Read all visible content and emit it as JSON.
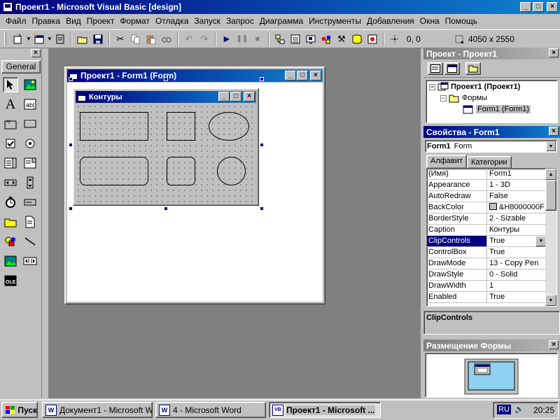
{
  "window": {
    "title": "Проект1 - Microsoft Visual Basic [design]",
    "controls": {
      "minimize": "_",
      "maximize": "□",
      "close": "×"
    }
  },
  "menu": [
    "Файл",
    "Правка",
    "Вид",
    "Проект",
    "Формат",
    "Отладка",
    "Запуск",
    "Запрос",
    "Диаграмма",
    "Инструменты",
    "Добавления",
    "Окна",
    "Помощь"
  ],
  "toolbar": {
    "position_readout": "0, 0",
    "size_readout": "4050 x 2550",
    "icons": [
      "add-project-icon",
      "add-form-icon",
      "menu-editor-icon",
      "open-icon",
      "save-icon",
      "cut-icon",
      "copy-icon",
      "paste-icon",
      "find-icon",
      "undo-icon",
      "redo-icon",
      "run-icon",
      "pause-icon",
      "stop-icon",
      "project-explorer-icon",
      "properties-window-icon",
      "form-layout-icon",
      "object-browser-icon",
      "toolbox-icon",
      "data-view-icon",
      "component-manager-icon"
    ]
  },
  "toolbox": {
    "tab_label": "General",
    "close": "×",
    "tools": [
      "pointer",
      "picturebox",
      "label",
      "textbox",
      "frame",
      "commandbutton",
      "checkbox",
      "optionbutton",
      "combobox",
      "listbox",
      "hscrollbar",
      "vscrollbar",
      "timer",
      "drivelistbox",
      "dirlistbox",
      "filelistbox",
      "shape",
      "line",
      "image",
      "data",
      "ole"
    ]
  },
  "form_designer": {
    "title": "Проект1 - Form1 (Form)",
    "form": {
      "caption": "Контуры",
      "shapes": [
        "rectangle",
        "square",
        "oval",
        "rounded-rectangle",
        "rounded-square",
        "circle"
      ]
    }
  },
  "project_panel": {
    "title": "Проект - Проект1",
    "tree": {
      "root": "Проект1 (Проект1)",
      "folder": "Формы",
      "item": "Form1 (Form1)"
    }
  },
  "properties_panel": {
    "title": "Свойства - Form1",
    "object_name": "Form1",
    "object_type": "Form",
    "tabs": [
      "Алфавит",
      "Категории"
    ],
    "active_tab": 0,
    "rows": [
      {
        "name": "(Имя)",
        "value": "Form1"
      },
      {
        "name": "Appearance",
        "value": "1 - 3D"
      },
      {
        "name": "AutoRedraw",
        "value": "False"
      },
      {
        "name": "BackColor",
        "value": "&H8000000F"
      },
      {
        "name": "BorderStyle",
        "value": "2 - Sizable"
      },
      {
        "name": "Caption",
        "value": "Контуры"
      },
      {
        "name": "ClipControls",
        "value": "True"
      },
      {
        "name": "ControlBox",
        "value": "True"
      },
      {
        "name": "DrawMode",
        "value": "13 - Copy Pen"
      },
      {
        "name": "DrawStyle",
        "value": "0 - Solid"
      },
      {
        "name": "DrawWidth",
        "value": "1"
      },
      {
        "name": "Enabled",
        "value": "True"
      }
    ],
    "selected_row": 6,
    "description_title": "ClipControls"
  },
  "layout_panel": {
    "title": "Размещение Формы"
  },
  "taskbar": {
    "start_label": "Пуск",
    "tasks": [
      {
        "label": "Документ1 - Microsoft W...",
        "icon": "W"
      },
      {
        "label": "4 - Microsoft Word",
        "icon": "W"
      },
      {
        "label": "Проект1 - Microsoft ...",
        "icon": "VB"
      }
    ],
    "language": "RU",
    "clock": "20:25"
  },
  "colors": {
    "title_active": "#000080",
    "title_gradient_end": "#1084d0",
    "face": "#c0c0c0",
    "mdi_background": "#808080",
    "selection": "#000080"
  }
}
